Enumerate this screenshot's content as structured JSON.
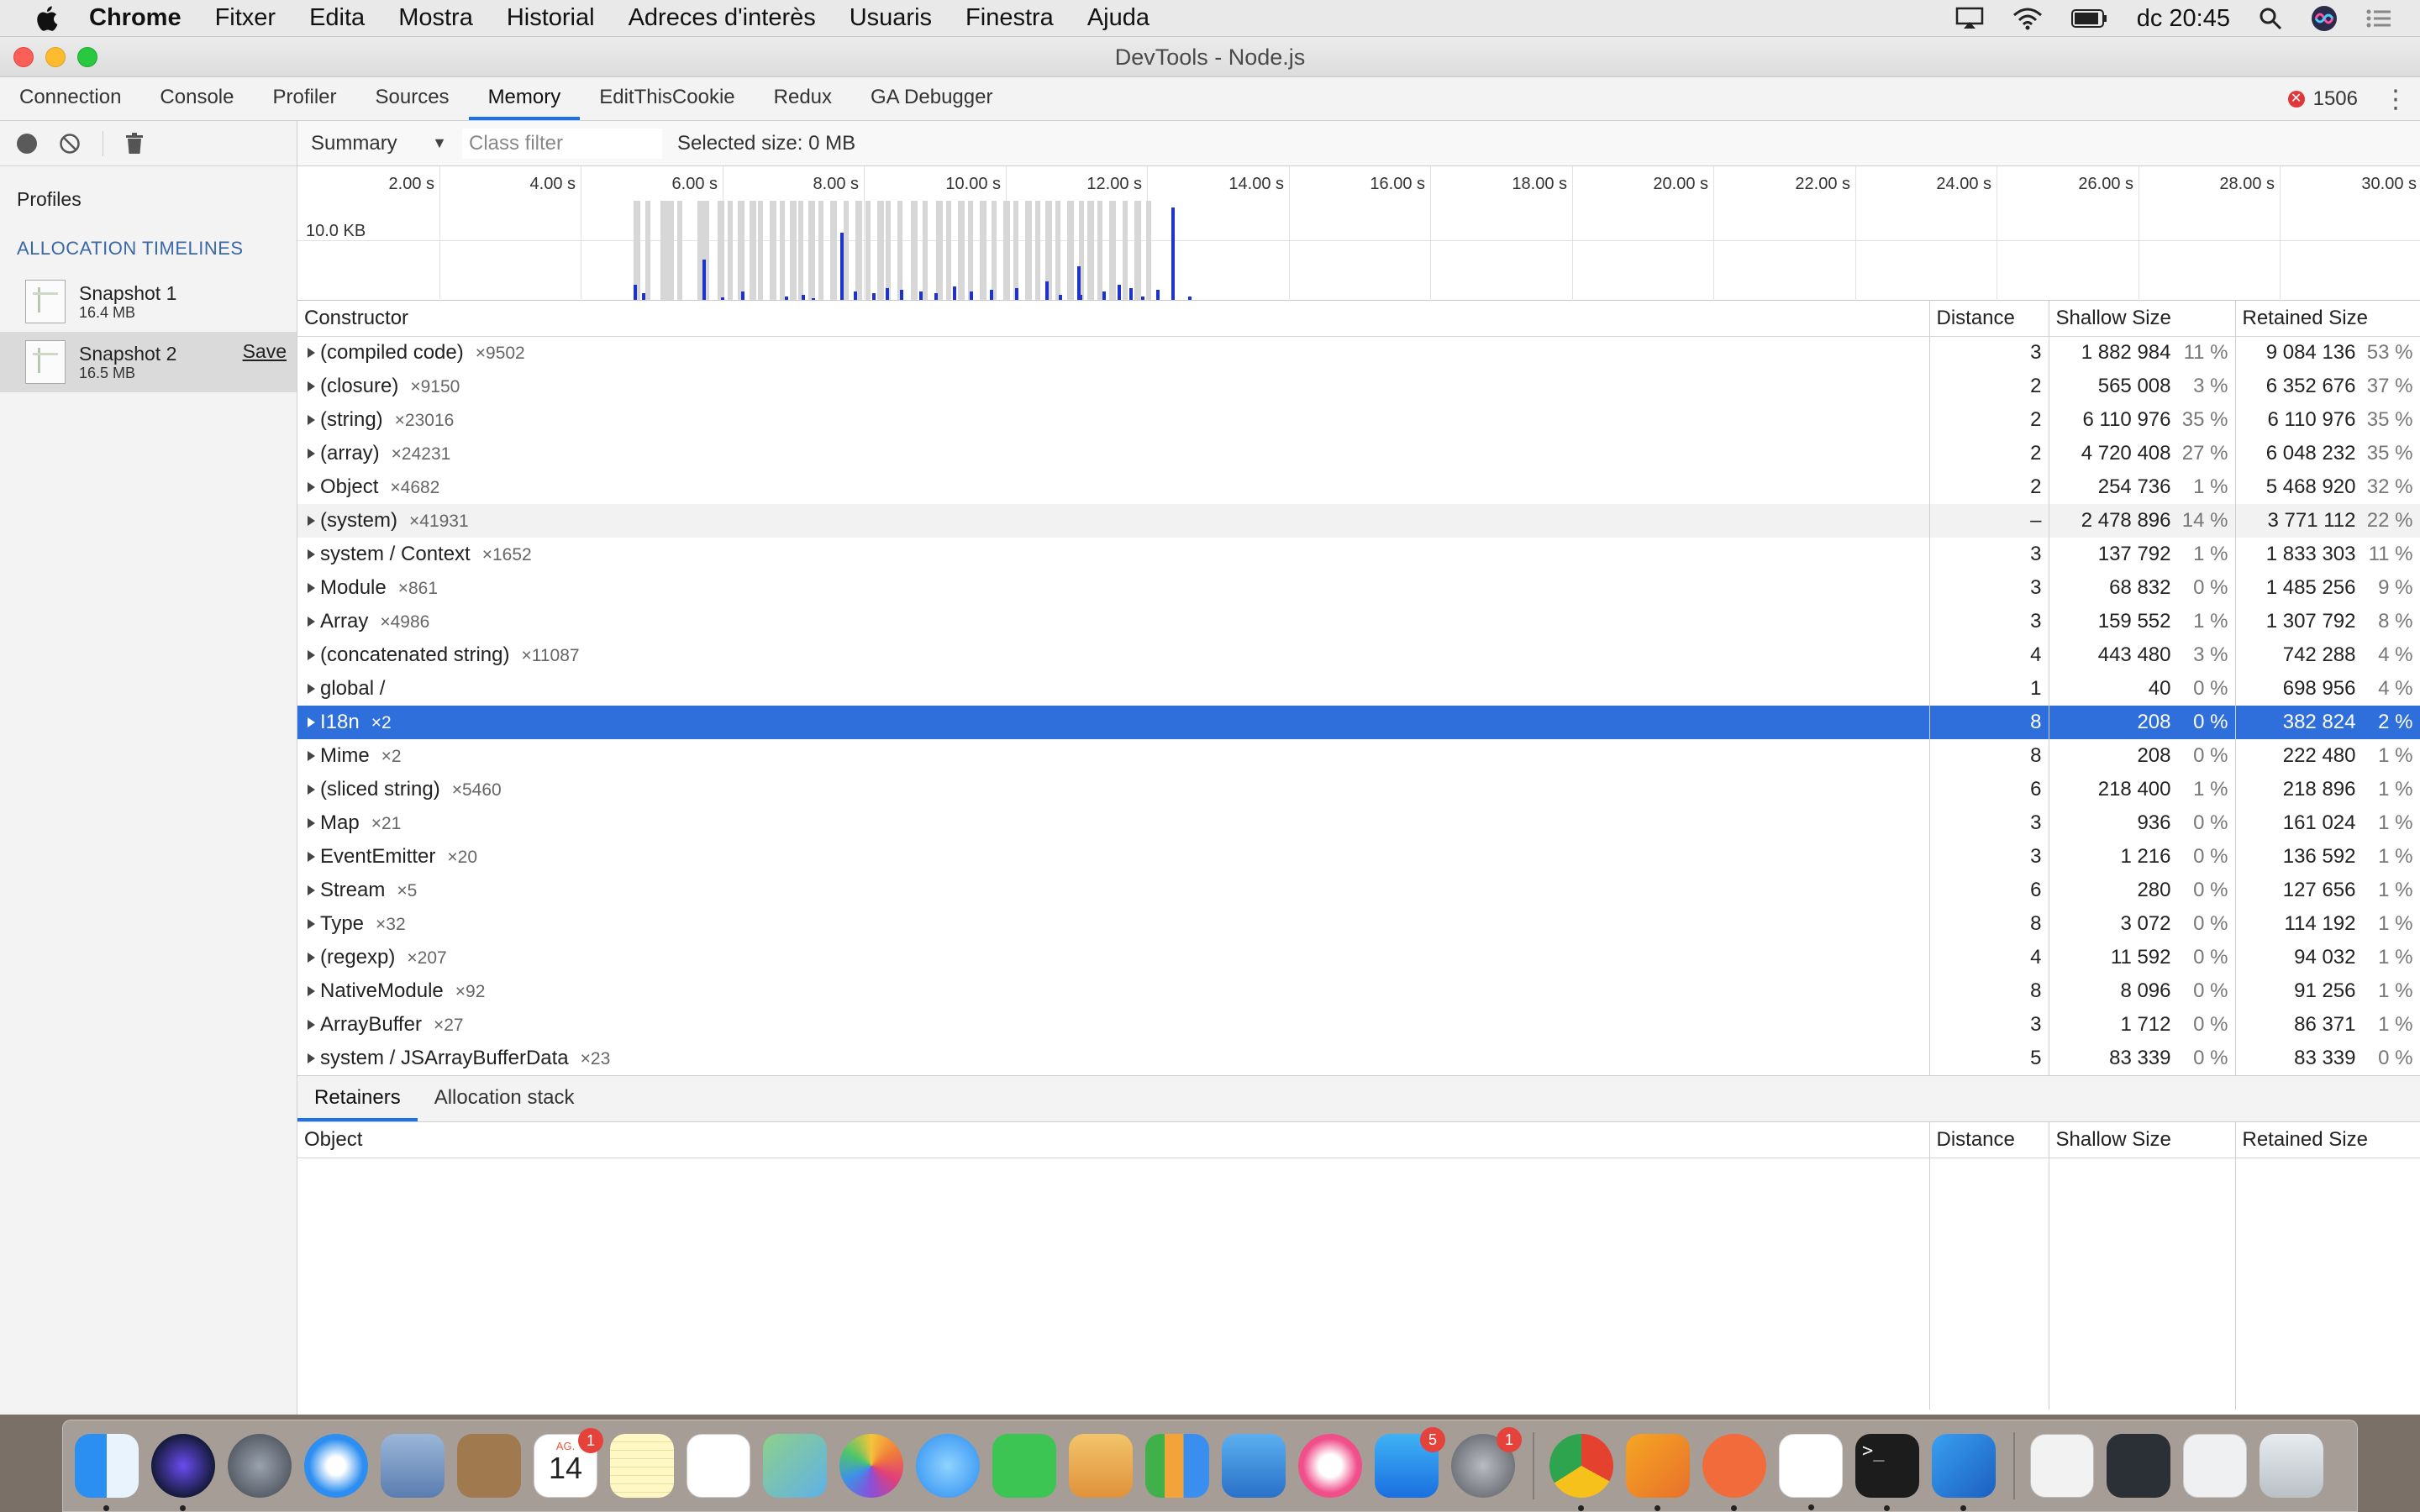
{
  "menubar": {
    "app": "Chrome",
    "items": [
      "Fitxer",
      "Edita",
      "Mostra",
      "Historial",
      "Adreces d'interès",
      "Usuaris",
      "Finestra",
      "Ajuda"
    ],
    "clock": "dc 20:45"
  },
  "window": {
    "title": "DevTools - Node.js"
  },
  "tabs": [
    "Connection",
    "Console",
    "Profiler",
    "Sources",
    "Memory",
    "EditThisCookie",
    "Redux",
    "GA Debugger"
  ],
  "active_tab": "Memory",
  "error_count": "1506",
  "sidebar": {
    "title": "Profiles",
    "section": "ALLOCATION TIMELINES",
    "snapshots": [
      {
        "name": "Snapshot 1",
        "size": "16.4 MB"
      },
      {
        "name": "Snapshot 2",
        "size": "16.5 MB",
        "action": "Save"
      }
    ]
  },
  "toolbar": {
    "view": "Summary",
    "filter_placeholder": "Class filter",
    "selected_size": "Selected size: 0 MB"
  },
  "timeline": {
    "y_label": "10.0 KB",
    "ticks": [
      "2.00 s",
      "4.00 s",
      "6.00 s",
      "8.00 s",
      "10.00 s",
      "12.00 s",
      "14.00 s",
      "16.00 s",
      "18.00 s",
      "20.00 s",
      "22.00 s",
      "24.00 s",
      "26.00 s",
      "28.00 s",
      "30.00 s"
    ]
  },
  "headers": {
    "constructor": "Constructor",
    "distance": "Distance",
    "shallow": "Shallow Size",
    "retained": "Retained Size"
  },
  "rows": [
    {
      "name": "(compiled code)",
      "count": "×9502",
      "distance": "3",
      "shallow": "1 882 984",
      "shallow_pct": "11 %",
      "retained": "9 084 136",
      "retained_pct": "53 %"
    },
    {
      "name": "(closure)",
      "count": "×9150",
      "distance": "2",
      "shallow": "565 008",
      "shallow_pct": "3 %",
      "retained": "6 352 676",
      "retained_pct": "37 %"
    },
    {
      "name": "(string)",
      "count": "×23016",
      "distance": "2",
      "shallow": "6 110 976",
      "shallow_pct": "35 %",
      "retained": "6 110 976",
      "retained_pct": "35 %"
    },
    {
      "name": "(array)",
      "count": "×24231",
      "distance": "2",
      "shallow": "4 720 408",
      "shallow_pct": "27 %",
      "retained": "6 048 232",
      "retained_pct": "35 %"
    },
    {
      "name": "Object",
      "count": "×4682",
      "distance": "2",
      "shallow": "254 736",
      "shallow_pct": "1 %",
      "retained": "5 468 920",
      "retained_pct": "32 %"
    },
    {
      "name": "(system)",
      "count": "×41931",
      "distance": "–",
      "shallow": "2 478 896",
      "shallow_pct": "14 %",
      "retained": "3 771 112",
      "retained_pct": "22 %"
    },
    {
      "name": "system / Context",
      "count": "×1652",
      "distance": "3",
      "shallow": "137 792",
      "shallow_pct": "1 %",
      "retained": "1 833 303",
      "retained_pct": "11 %"
    },
    {
      "name": "Module",
      "count": "×861",
      "distance": "3",
      "shallow": "68 832",
      "shallow_pct": "0 %",
      "retained": "1 485 256",
      "retained_pct": "9 %"
    },
    {
      "name": "Array",
      "count": "×4986",
      "distance": "3",
      "shallow": "159 552",
      "shallow_pct": "1 %",
      "retained": "1 307 792",
      "retained_pct": "8 %"
    },
    {
      "name": "(concatenated string)",
      "count": "×11087",
      "distance": "4",
      "shallow": "443 480",
      "shallow_pct": "3 %",
      "retained": "742 288",
      "retained_pct": "4 %"
    },
    {
      "name": "global /",
      "count": "",
      "distance": "1",
      "shallow": "40",
      "shallow_pct": "0 %",
      "retained": "698 956",
      "retained_pct": "4 %"
    },
    {
      "name": "I18n",
      "count": "×2",
      "distance": "8",
      "shallow": "208",
      "shallow_pct": "0 %",
      "retained": "382 824",
      "retained_pct": "2 %"
    },
    {
      "name": "Mime",
      "count": "×2",
      "distance": "8",
      "shallow": "208",
      "shallow_pct": "0 %",
      "retained": "222 480",
      "retained_pct": "1 %"
    },
    {
      "name": "(sliced string)",
      "count": "×5460",
      "distance": "6",
      "shallow": "218 400",
      "shallow_pct": "1 %",
      "retained": "218 896",
      "retained_pct": "1 %"
    },
    {
      "name": "Map",
      "count": "×21",
      "distance": "3",
      "shallow": "936",
      "shallow_pct": "0 %",
      "retained": "161 024",
      "retained_pct": "1 %"
    },
    {
      "name": "EventEmitter",
      "count": "×20",
      "distance": "3",
      "shallow": "1 216",
      "shallow_pct": "0 %",
      "retained": "136 592",
      "retained_pct": "1 %"
    },
    {
      "name": "Stream",
      "count": "×5",
      "distance": "6",
      "shallow": "280",
      "shallow_pct": "0 %",
      "retained": "127 656",
      "retained_pct": "1 %"
    },
    {
      "name": "Type",
      "count": "×32",
      "distance": "8",
      "shallow": "3 072",
      "shallow_pct": "0 %",
      "retained": "114 192",
      "retained_pct": "1 %"
    },
    {
      "name": "(regexp)",
      "count": "×207",
      "distance": "4",
      "shallow": "11 592",
      "shallow_pct": "0 %",
      "retained": "94 032",
      "retained_pct": "1 %"
    },
    {
      "name": "NativeModule",
      "count": "×92",
      "distance": "8",
      "shallow": "8 096",
      "shallow_pct": "0 %",
      "retained": "91 256",
      "retained_pct": "1 %"
    },
    {
      "name": "ArrayBuffer",
      "count": "×27",
      "distance": "3",
      "shallow": "1 712",
      "shallow_pct": "0 %",
      "retained": "86 371",
      "retained_pct": "1 %"
    },
    {
      "name": "system / JSArrayBufferData",
      "count": "×23",
      "distance": "5",
      "shallow": "83 339",
      "shallow_pct": "0 %",
      "retained": "83 339",
      "retained_pct": "0 %"
    }
  ],
  "selected_row": "I18n",
  "bottom": {
    "tabs": [
      "Retainers",
      "Allocation stack"
    ],
    "headers": {
      "object": "Object",
      "distance": "Distance",
      "shallow": "Shallow Size",
      "retained": "Retained Size"
    }
  },
  "dock": {
    "calendar_month": "AG.",
    "calendar_day": "14",
    "badges": {
      "calendar": "1",
      "appstore": "5",
      "preferences": "1"
    }
  }
}
